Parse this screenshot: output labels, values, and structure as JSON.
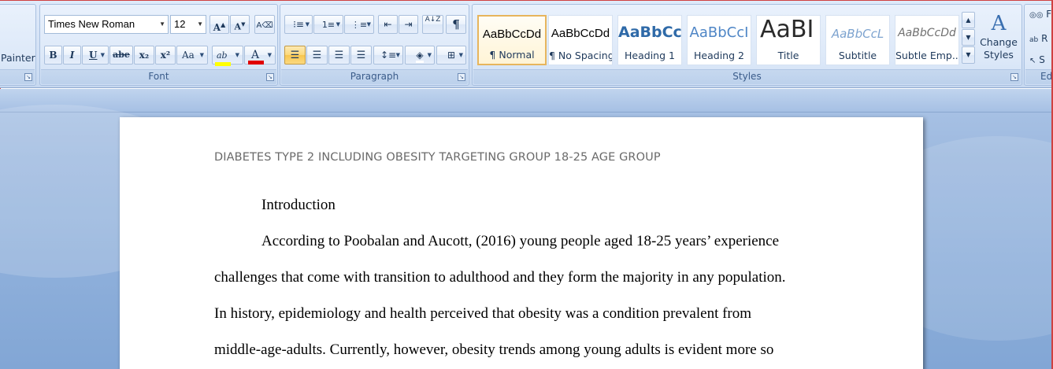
{
  "ribbon": {
    "clipboard": {
      "format_painter_label": "Painter"
    },
    "font": {
      "group_label": "Font",
      "font_name": "Times New Roman",
      "font_size": "12",
      "grow_font": "A",
      "shrink_font": "A",
      "bold": "B",
      "italic": "I",
      "underline": "U",
      "strikethrough": "abe",
      "subscript": "x₂",
      "superscript": "x²",
      "change_case": "Aa",
      "highlight": "ab",
      "font_color": "A"
    },
    "paragraph": {
      "group_label": "Paragraph",
      "sort": "A↓Z",
      "show_marks": "¶"
    },
    "styles": {
      "group_label": "Styles",
      "tiles": [
        {
          "sample": "AaBbCcDd",
          "name": "¶ Normal"
        },
        {
          "sample": "AaBbCcDd",
          "name": "¶ No Spacing"
        },
        {
          "sample": "AaBbCc",
          "name": "Heading 1"
        },
        {
          "sample": "AaBbCcI",
          "name": "Heading 2"
        },
        {
          "sample": "AaBI",
          "name": "Title"
        },
        {
          "sample": "AaBbCcL",
          "name": "Subtitle"
        },
        {
          "sample": "AaBbCcDd",
          "name": "Subtle Emp..."
        }
      ],
      "change_styles": "Change Styles"
    },
    "editing": {
      "group_label_partial": "Ed",
      "items": [
        "F",
        "R",
        "S"
      ]
    }
  },
  "document": {
    "header": "DIABETES TYPE 2 INCLUDING OBESITY TARGETING GROUP 18-25 AGE GROUP",
    "lines": [
      "Introduction",
      "According to Poobalan and Aucott, (2016) young people aged 18-25 years’ experience",
      "challenges that come with transition to adulthood and they form the majority in any population.",
      "In history, epidemiology and health perceived that obesity was a condition prevalent from",
      "middle-age-adults. Currently, however, obesity trends among young adults is evident more so"
    ]
  },
  "colors": {
    "highlight_yellow": "#ffff00",
    "font_red": "#e00000",
    "selected_style_border": "#e7b55d"
  }
}
